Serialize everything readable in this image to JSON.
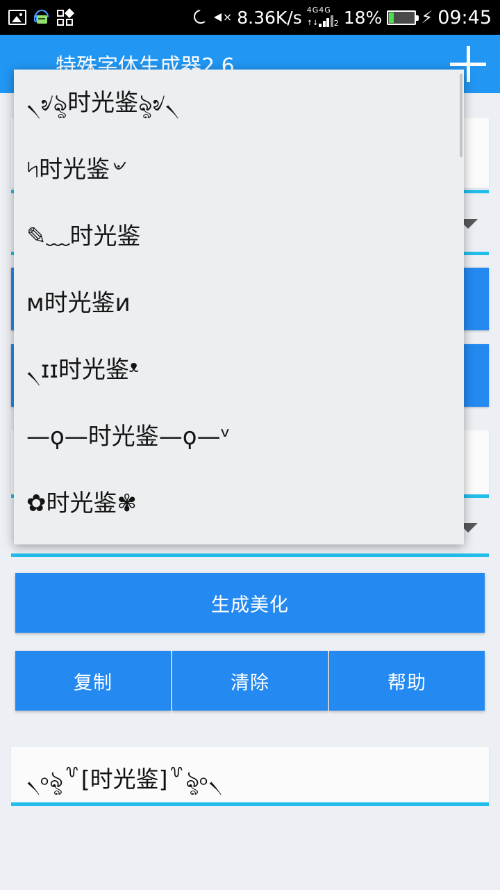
{
  "statusbar": {
    "icons_left": [
      "image-icon",
      "headset-chat-icon",
      "apps-grid-icon"
    ],
    "dnd_icon": "moon-icon",
    "mute_icon": "volume-mute-icon",
    "net_speed": "8.36K/s",
    "network_label_1": "4G",
    "network_label_2": "4G",
    "sim_index": "2",
    "battery_percent": "18%",
    "battery_level": 18,
    "charging_icon": "lightning-bolt-icon",
    "clock": "09:45"
  },
  "appbar": {
    "title": "特殊字体生成器2.6",
    "add_label": "+",
    "background": "#2196f3"
  },
  "dialog": {
    "items": [
      {
        "sample": "৲৶ৡ时光鉴ৡ৶৲"
      },
      {
        "sample": "৸时光鉴৺"
      },
      {
        "sample": "✎﹏时光鉴"
      },
      {
        "sample": "ᴍ时光鉴ᴎ"
      },
      {
        "sample": "৲ɪɪ时光鉴ᵜ"
      },
      {
        "sample": "—ϙ—时光鉴—ϙ—ᵛ"
      },
      {
        "sample": "✿时光鉴✾"
      }
    ],
    "background": "#eceef0"
  },
  "background_form": {
    "field_1_underline_color": "#22bdea",
    "caret_icon": "chevron-down-icon",
    "field_2_underline_color": "#22bdea",
    "field_3_underline_color": "#22bdea",
    "button_color": "#2489f0"
  },
  "actions": {
    "generate": "生成美化",
    "copy": "复制",
    "clear": "清除",
    "help": "帮助",
    "button_color": "#2489f0"
  },
  "output": {
    "text": "৲৹ৡ꒷[时光鉴]꒷ৡ৹৲",
    "underline_color": "#22bdea"
  }
}
